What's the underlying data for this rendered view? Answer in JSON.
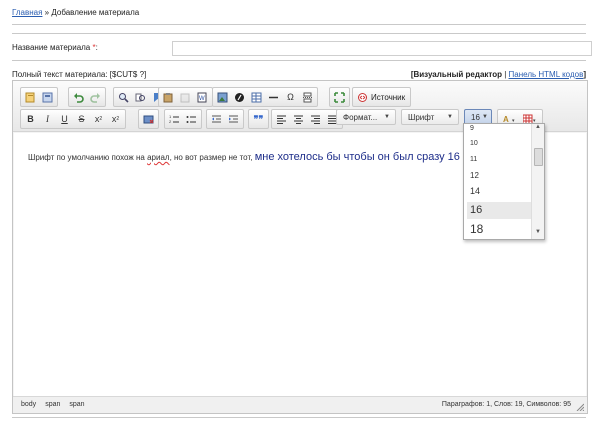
{
  "breadcrumb": {
    "home": "Главная",
    "separator": " » ",
    "current": "Добавление материала"
  },
  "form": {
    "title_label": "Название материала",
    "required_mark": "*",
    "title_colon": ":",
    "title_value": "",
    "fulltext_label": "Полный текст материала: [$CUT$ ?]"
  },
  "modes": {
    "visual": "[Визуальный редактор",
    "sep": " | ",
    "html": "Панель HTML кодов",
    "close": "]"
  },
  "toolbar": {
    "source_label": "Источник",
    "format_label": "Формат...",
    "font_label": "Шрифт",
    "size_label": "16"
  },
  "content": {
    "text_small_a": "Шрифт по умолчанию похож на ",
    "text_misspelled": "ариал",
    "text_small_b": ", но вот размер не тот, ",
    "text_big": "мне хотелось бы чтобы он был сразу 16"
  },
  "size_dropdown": {
    "options": [
      "9",
      "10",
      "11",
      "12",
      "14",
      "16",
      "18"
    ],
    "selected": "16"
  },
  "status": {
    "path": [
      "body",
      "span",
      "span"
    ],
    "counts": "Параграфов: 1, Слов: 19, Символов: 95"
  }
}
